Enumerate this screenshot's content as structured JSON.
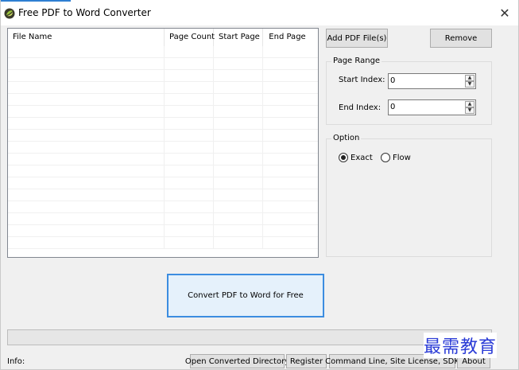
{
  "window": {
    "title": "Free PDF to Word Converter",
    "close_glyph": "✕"
  },
  "file_list": {
    "columns": [
      "File Name",
      "Page Count",
      "Start Page",
      "End Page"
    ],
    "rows": []
  },
  "buttons": {
    "add_pdf": "Add PDF File(s)",
    "remove": "Remove",
    "convert": "Convert PDF to Word for Free"
  },
  "page_range": {
    "group_label": "Page Range",
    "start_label": "Start Index:",
    "start_value": "0",
    "end_label": "End Index:",
    "end_value": "0"
  },
  "option": {
    "group_label": "Option",
    "exact_label": "Exact",
    "flow_label": "Flow",
    "selected": "Exact"
  },
  "footer": {
    "info_label": "Info:",
    "open_dir": "Open Converted Directory",
    "register": "Register",
    "command_line": "Command Line, Site License, SDK",
    "about": "About"
  },
  "watermark": "最需教育",
  "colors": {
    "accent": "#2e7fd2",
    "convert_border": "#3c8de0",
    "watermark": "#2a3bd6"
  },
  "icons": {
    "app": "app-logo-icon"
  }
}
